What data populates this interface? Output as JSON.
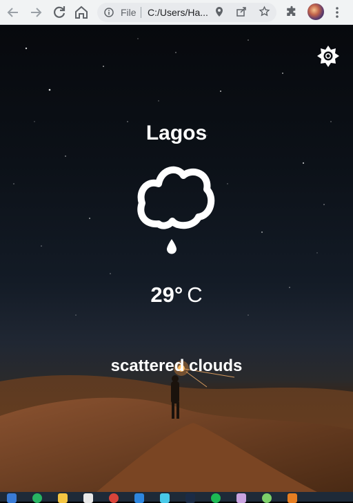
{
  "browser": {
    "scheme_label": "File",
    "url": "C:/Users/Ha...",
    "icons": [
      "back-arrow-icon",
      "forward-arrow-icon",
      "reload-icon",
      "home-icon",
      "info-icon",
      "location-pin-icon",
      "share-icon",
      "star-icon",
      "extensions-puzzle-icon",
      "profile-avatar",
      "more-vert-icon"
    ]
  },
  "weather": {
    "city": "Lagos",
    "temperature": "29°",
    "unit": "C",
    "description": "scattered clouds",
    "icons": [
      "settings-gear-icon",
      "cloud-icon",
      "raindrop-icon"
    ]
  },
  "taskbar": {
    "icons": [
      "windows-start-icon",
      "chrome-icon",
      "file-explorer-icon",
      "store-icon",
      "app-red-icon",
      "vscode-icon",
      "app-blue-icon",
      "app-dark-icon",
      "spotify-icon",
      "app-photo-icon",
      "app-green-icon",
      "app-orange-icon"
    ]
  },
  "colors": {
    "text": "#ffffff",
    "sky_top": "#07090d",
    "dune": "#6a3e1c",
    "chrome_bg": "#f1f3f4"
  }
}
